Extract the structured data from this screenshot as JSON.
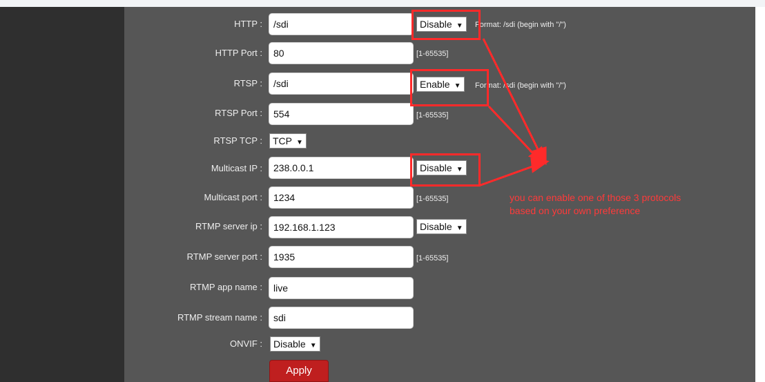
{
  "fields": [
    {
      "label": "HTTP :",
      "value": "/sdi",
      "select": "Disable",
      "hint": "Format: /sdi (begin with \"/\")"
    },
    {
      "label": "HTTP Port :",
      "value": "80",
      "hint": "[1-65535]"
    },
    {
      "label": "RTSP :",
      "value": "/sdi",
      "select": "Enable",
      "hint": "Format: /sdi (begin with \"/\")"
    },
    {
      "label": "RTSP Port :",
      "value": "554",
      "hint": "[1-65535]"
    },
    {
      "label": "RTSP TCP :",
      "select": "TCP"
    },
    {
      "label": "Multicast IP :",
      "value": "238.0.0.1",
      "select": "Disable"
    },
    {
      "label": "Multicast port :",
      "value": "1234",
      "hint": "[1-65535]"
    },
    {
      "label": "RTMP server ip :",
      "value": "192.168.1.123",
      "select": "Disable"
    },
    {
      "label": "RTMP server port :",
      "value": "1935",
      "hint": "[1-65535]"
    },
    {
      "label": "RTMP app name :",
      "value": "live"
    },
    {
      "label": "RTMP stream name :",
      "value": "sdi"
    },
    {
      "label": "ONVIF :",
      "select": "Disable"
    }
  ],
  "apply_label": "Apply",
  "annotation": {
    "line1": "you can enable one of those 3 protocols",
    "line2": "based on your own preference"
  },
  "colors": {
    "annotation": "#ff2a2a",
    "apply_button": "#bf1f1f",
    "panel": "#565656",
    "sidebar": "#2f2f2f"
  }
}
